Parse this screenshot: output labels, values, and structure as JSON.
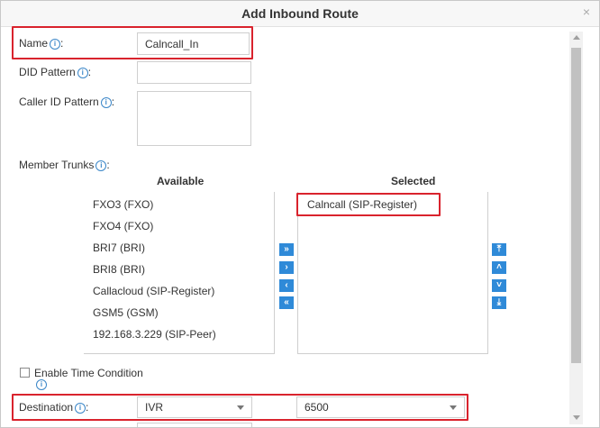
{
  "dialog": {
    "title": "Add Inbound Route",
    "close_glyph": "×"
  },
  "form": {
    "name": {
      "label": "Name",
      "value": "Calncall_In"
    },
    "did_pattern": {
      "label": "DID Pattern",
      "value": ""
    },
    "caller_id_pattern": {
      "label": "Caller ID Pattern",
      "value": ""
    },
    "member_trunks": {
      "label": "Member Trunks",
      "available_header": "Available",
      "selected_header": "Selected",
      "available": [
        "FXO3 (FXO)",
        "FXO4 (FXO)",
        "BRI7 (BRI)",
        "BRI8 (BRI)",
        "Callacloud (SIP-Register)",
        "GSM5 (GSM)",
        "192.168.3.229 (SIP-Peer)"
      ],
      "selected": [
        "Calncall (SIP-Register)"
      ],
      "move_buttons": [
        "»",
        "›",
        "‹",
        "«"
      ],
      "order_buttons": [
        "⤒",
        "˄",
        "˅",
        "⤓"
      ]
    },
    "enable_time_condition": {
      "label": "Enable Time Condition",
      "checked": false
    },
    "destination": {
      "label": "Destination",
      "type_value": "IVR",
      "target_value": "6500"
    }
  },
  "colors": {
    "accent": "#2f8ad8",
    "highlight": "#d9232d"
  },
  "icons": {
    "info": "i"
  }
}
